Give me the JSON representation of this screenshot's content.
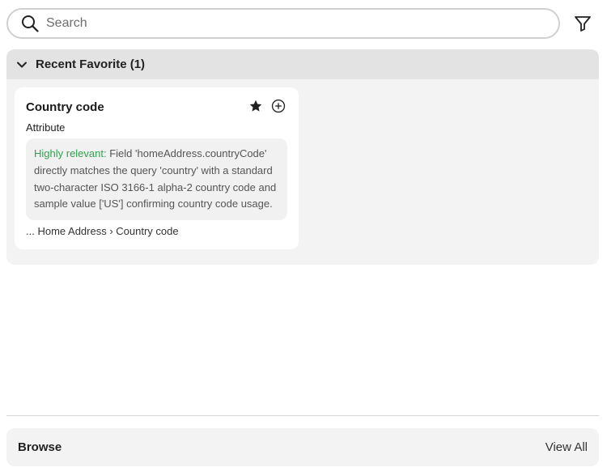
{
  "search": {
    "placeholder": "Search",
    "value": ""
  },
  "icons": {
    "search": "search-icon",
    "filter": "filter-icon",
    "collapse": "chevron-down-icon",
    "favorite": "star-icon",
    "add": "plus-circle-icon"
  },
  "recent_favorites": {
    "title": "Recent Favorite (1)",
    "items": [
      {
        "name": "Country code",
        "type": "Attribute",
        "relevance_label": "Highly relevant:",
        "reason": " Field 'homeAddress.countryCode' directly matches the query 'country' with a standard two-character ISO 3166-1 alpha-2 country code and sample value ['US'] confirming country code usage.",
        "path": "... Home Address › Country code"
      }
    ]
  },
  "browse": {
    "title": "Browse",
    "view_all_label": "View All"
  },
  "colors": {
    "relevance": "#2da44e",
    "section_bg": "#f3f3f3",
    "header_bg": "#e3e3e3"
  }
}
